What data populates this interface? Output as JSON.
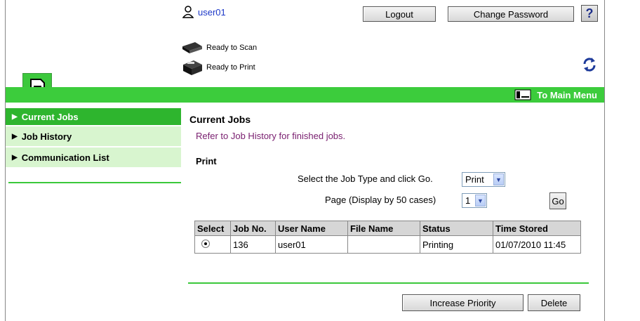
{
  "header": {
    "username": "user01",
    "logout_label": "Logout",
    "change_password_label": "Change Password",
    "help_label": "?"
  },
  "device_status": {
    "scan": "Ready to Scan",
    "print": "Ready to Print"
  },
  "menu_bar": {
    "main_menu_label": "To Main Menu"
  },
  "sidebar": {
    "items": [
      {
        "label": "Current Jobs"
      },
      {
        "label": "Job History"
      },
      {
        "label": "Communication List"
      }
    ]
  },
  "main": {
    "title": "Current Jobs",
    "subtitle": "Refer to Job History for finished jobs.",
    "section_label": "Print",
    "job_type_label": "Select the Job Type and click Go.",
    "job_type_value": "Print",
    "page_label": "Page (Display by 50 cases)",
    "page_value": "1",
    "go_label": "Go"
  },
  "table": {
    "headers": [
      "Select",
      "Job No.",
      "User Name",
      "File Name",
      "Status",
      "Time Stored"
    ],
    "rows": [
      {
        "job_no": "136",
        "user": "user01",
        "file": "",
        "status": "Printing",
        "time": "01/07/2010 11:45"
      }
    ]
  },
  "actions": {
    "increase_priority_label": "Increase Priority",
    "delete_label": "Delete"
  },
  "colors": {
    "accent_green": "#3ccc3c",
    "sidebar_active": "#2eb52e",
    "sidebar_bg": "#d8f5cf",
    "link_blue": "#1c38c8",
    "subtitle_purple": "#7a2070"
  }
}
